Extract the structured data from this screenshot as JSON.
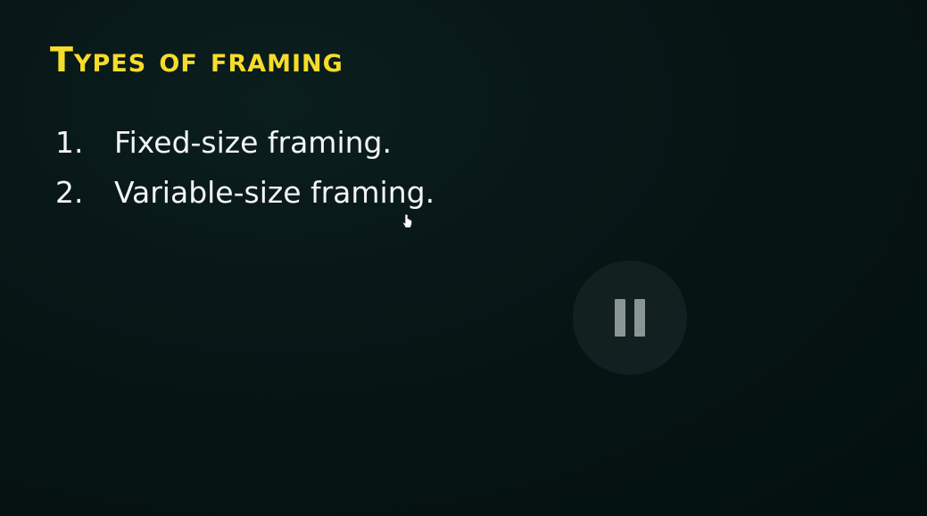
{
  "slide": {
    "title": "Types of framing",
    "items": [
      {
        "number": "1.",
        "text": "Fixed-size framing."
      },
      {
        "number": "2.",
        "text": "Variable-size framing."
      }
    ]
  },
  "colors": {
    "background": "#061212",
    "title": "#f6dc2a",
    "body_text": "#f4f4f4",
    "pause_icon": "#8a9696"
  },
  "icons": {
    "player_control": "pause-icon",
    "pointer": "hand-cursor-icon"
  }
}
